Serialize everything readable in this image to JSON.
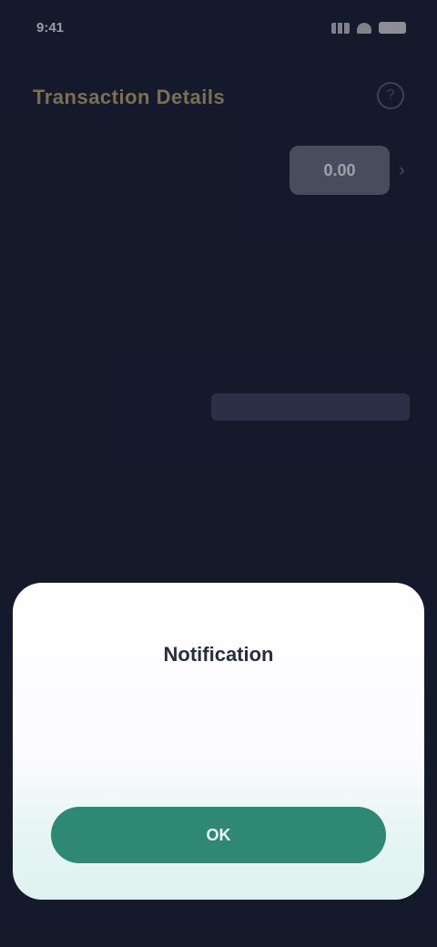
{
  "status_bar": {
    "time": "9:41"
  },
  "header": {
    "title": "Transaction Details",
    "help_glyph": "?"
  },
  "balance": {
    "chip_text": "0.00",
    "sub_text": "",
    "sub_text_2": ""
  },
  "notice": {
    "text": ""
  },
  "details": {
    "section_label": "",
    "row_label": "",
    "row_value": "",
    "description": "",
    "description_2": ""
  },
  "modal": {
    "title": "Notification",
    "body": "",
    "button_label": "OK"
  },
  "colors": {
    "background": "#1b2136",
    "title_gold": "#b9a774",
    "button_teal": "#2f8874",
    "modal_bg": "#ffffff"
  }
}
